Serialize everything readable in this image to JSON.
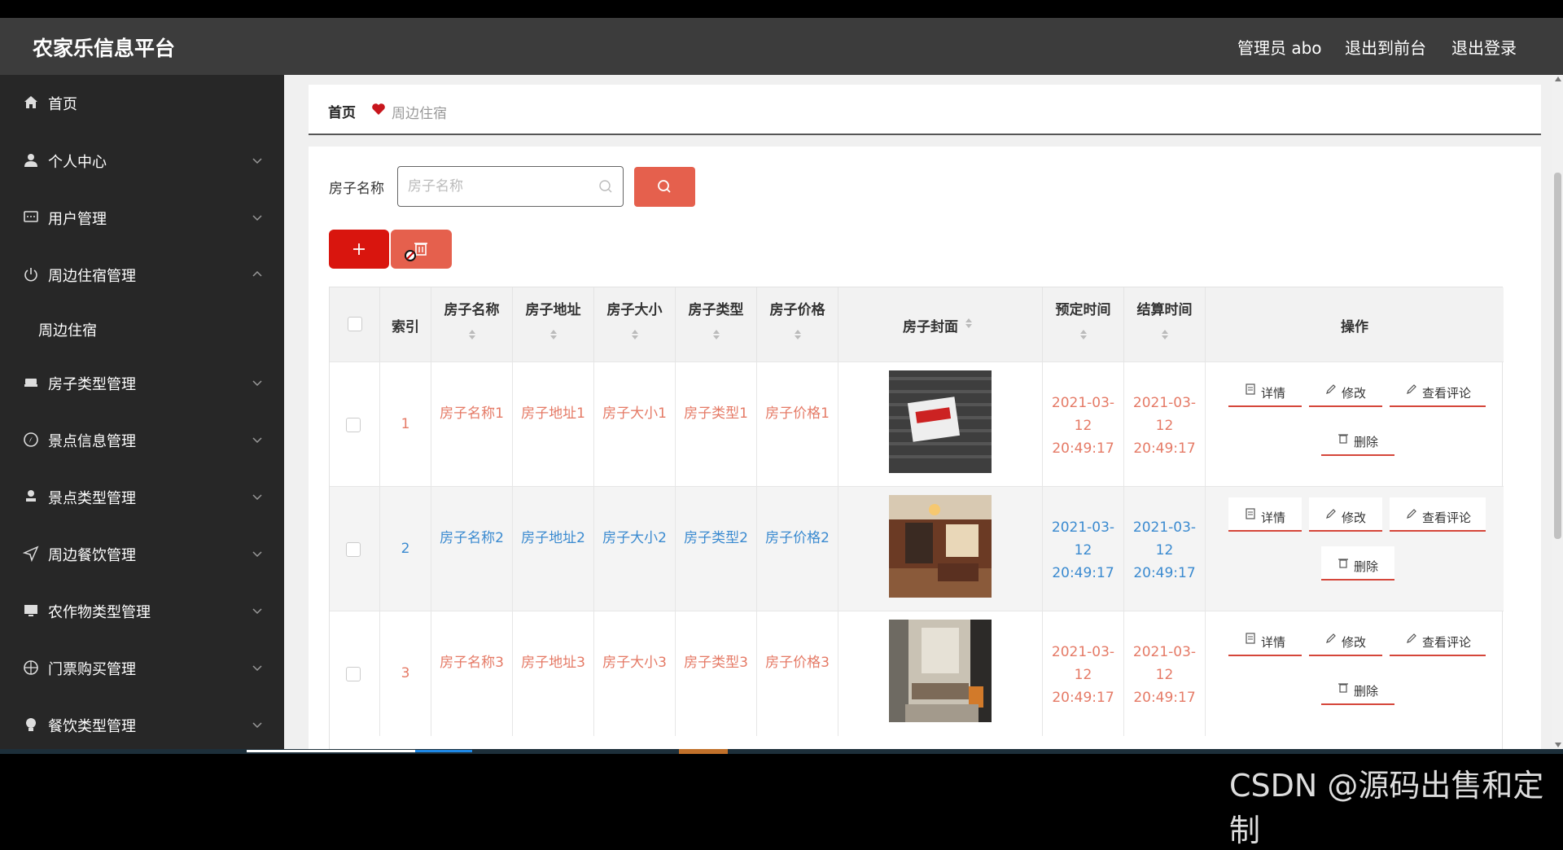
{
  "header": {
    "title": "农家乐信息平台",
    "user_label": "管理员 abo",
    "to_frontend": "退出到前台",
    "logout": "退出登录"
  },
  "sidebar": {
    "items": [
      {
        "label": "首页",
        "icon": "home-icon",
        "chevron": ""
      },
      {
        "label": "个人中心",
        "icon": "user-icon",
        "chevron": "down"
      },
      {
        "label": "用户管理",
        "icon": "message-icon",
        "chevron": "down"
      },
      {
        "label": "周边住宿管理",
        "icon": "power-icon",
        "chevron": "up"
      },
      {
        "label": "周边住宿",
        "icon": "",
        "chevron": ""
      },
      {
        "label": "房子类型管理",
        "icon": "bed-icon",
        "chevron": "down"
      },
      {
        "label": "景点信息管理",
        "icon": "compass-icon",
        "chevron": "down"
      },
      {
        "label": "景点类型管理",
        "icon": "stamp-icon",
        "chevron": "down"
      },
      {
        "label": "周边餐饮管理",
        "icon": "send-icon",
        "chevron": "down"
      },
      {
        "label": "农作物类型管理",
        "icon": "monitor-icon",
        "chevron": "down"
      },
      {
        "label": "门票购买管理",
        "icon": "aim-icon",
        "chevron": "down"
      },
      {
        "label": "餐饮类型管理",
        "icon": "bulb-icon",
        "chevron": "down"
      }
    ]
  },
  "breadcrumb": {
    "home": "首页",
    "current": "周边住宿",
    "separator_icon": "heart-icon"
  },
  "search": {
    "label": "房子名称",
    "placeholder": "房子名称",
    "value": ""
  },
  "table": {
    "headers": {
      "index": "索引",
      "name": "房子名称",
      "address": "房子地址",
      "size": "房子大小",
      "type": "房子类型",
      "price": "房子价格",
      "cover": "房子封面",
      "reserve_time": "预定时间",
      "settle_time": "结算时间",
      "actions": "操作"
    },
    "rows": [
      {
        "index": "1",
        "name": "房子名称1",
        "address": "房子地址1",
        "size": "房子大小1",
        "type": "房子类型1",
        "price": "房子价格1",
        "cover": "sign-photo",
        "reserve_time": "2021-03-12 20:49:17",
        "settle_time": "2021-03-12 20:49:17",
        "color": "red"
      },
      {
        "index": "2",
        "name": "房子名称2",
        "address": "房子地址2",
        "size": "房子大小2",
        "type": "房子类型2",
        "price": "房子价格2",
        "cover": "bedroom-photo",
        "reserve_time": "2021-03-12 20:49:17",
        "settle_time": "2021-03-12 20:49:17",
        "color": "blue"
      },
      {
        "index": "3",
        "name": "房子名称3",
        "address": "房子地址3",
        "size": "房子大小3",
        "type": "房子类型3",
        "price": "房子价格3",
        "cover": "living-room-photo",
        "reserve_time": "2021-03-12 20:49:17",
        "settle_time": "2021-03-12 20:49:17",
        "color": "red"
      }
    ],
    "actions": {
      "detail": "详情",
      "edit": "修改",
      "comments": "查看评论",
      "delete": "删除"
    }
  },
  "watermark": "CSDN @源码出售和定制",
  "colors": {
    "accent": "#e5604d",
    "danger": "#d9150e",
    "row_red": "#e57a66",
    "row_blue": "#3a8ad0"
  }
}
